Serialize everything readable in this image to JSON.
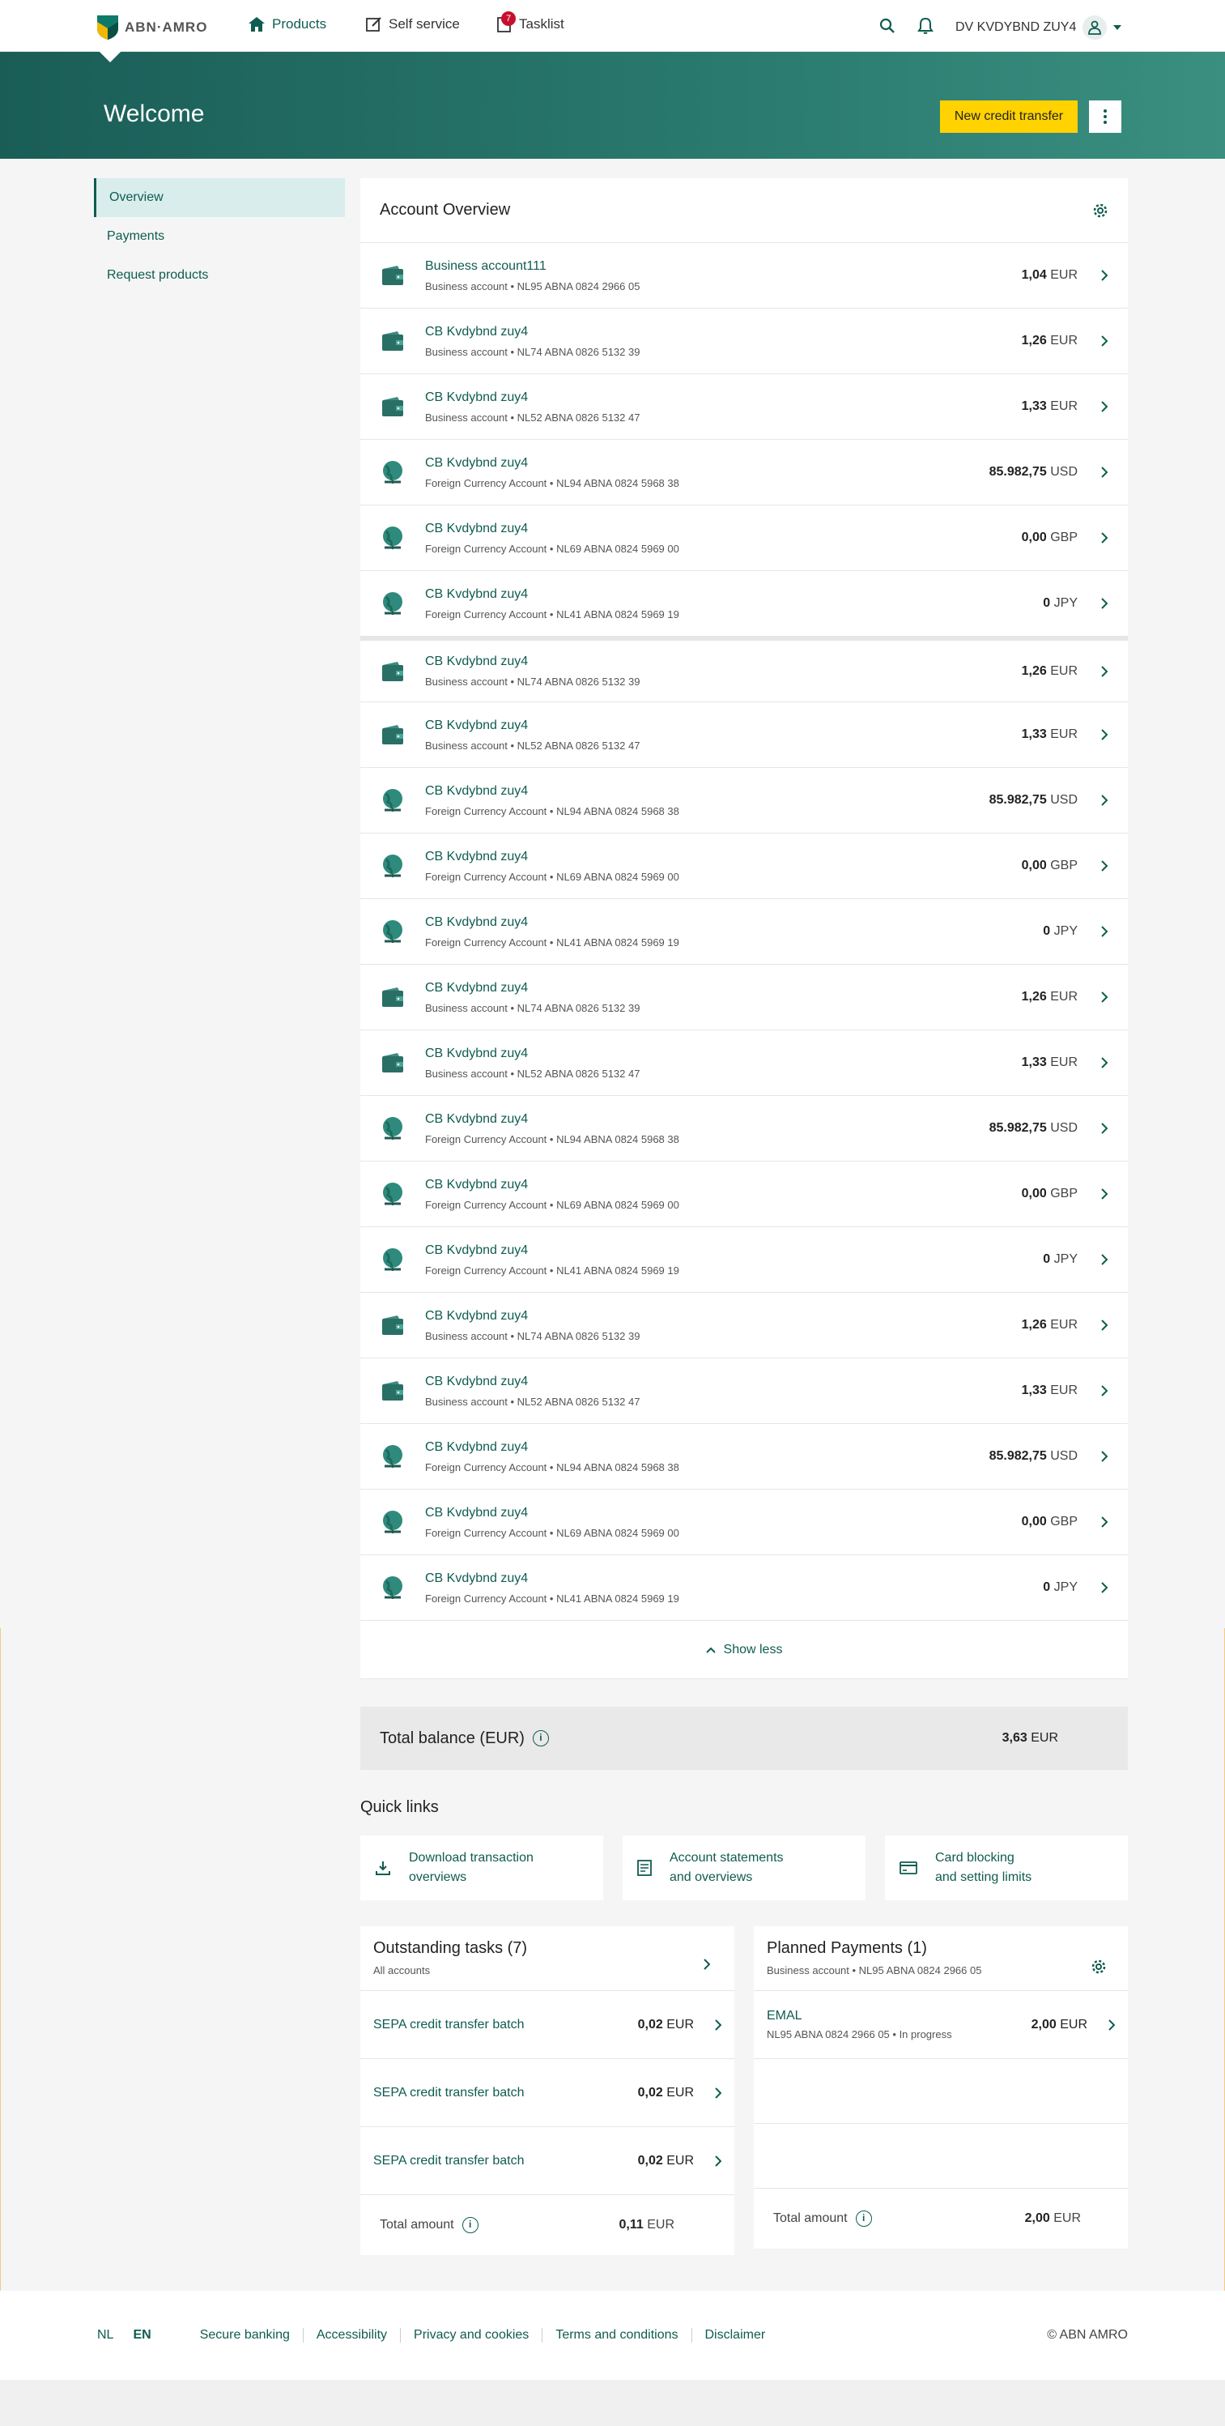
{
  "nav": {
    "logo_text": "ABN·AMRO",
    "items": [
      {
        "label": "Products",
        "icon": "home-icon"
      },
      {
        "label": "Self service",
        "icon": "edit-icon"
      },
      {
        "label": "Tasklist",
        "icon": "task-icon",
        "badge": "7"
      }
    ],
    "user_name": "DV KVDYBND ZUY4"
  },
  "hero": {
    "title": "Welcome",
    "primary_button": "New credit transfer"
  },
  "sidebar": {
    "items": [
      {
        "label": "Overview",
        "active": true
      },
      {
        "label": "Payments"
      },
      {
        "label": "Request products"
      }
    ]
  },
  "accounts": {
    "title": "Account Overview",
    "rows": [
      {
        "name": "Business account111",
        "sub": "Business account • NL95 ABNA 0824 2966 05",
        "amount": "1,04",
        "currency": "EUR",
        "type": "business"
      },
      {
        "name": "CB Kvdybnd zuy4",
        "sub": "Business account • NL74 ABNA 0826 5132 39",
        "amount": "1,26",
        "currency": "EUR",
        "type": "business"
      },
      {
        "name": "CB Kvdybnd zuy4",
        "sub": "Business account • NL52 ABNA 0826 5132 47",
        "amount": "1,33",
        "currency": "EUR",
        "type": "business"
      },
      {
        "name": "CB Kvdybnd zuy4",
        "sub": "Foreign Currency Account • NL94 ABNA 0824 5968 38",
        "amount": "85.982,75",
        "currency": "USD",
        "type": "foreign"
      },
      {
        "name": "CB Kvdybnd zuy4",
        "sub": "Foreign Currency Account • NL69 ABNA 0824 5969 00",
        "amount": "0,00",
        "currency": "GBP",
        "type": "foreign"
      },
      {
        "name": "CB Kvdybnd zuy4",
        "sub": "Foreign Currency Account • NL41 ABNA 0824 5969 19",
        "amount": "0",
        "currency": "JPY",
        "type": "foreign"
      },
      {
        "name": "CB Kvdybnd zuy4",
        "sub": "Business account • NL74 ABNA 0826 5132 39",
        "amount": "1,26",
        "currency": "EUR",
        "type": "business"
      },
      {
        "name": "CB Kvdybnd zuy4",
        "sub": "Business account • NL52 ABNA 0826 5132 47",
        "amount": "1,33",
        "currency": "EUR",
        "type": "business"
      },
      {
        "name": "CB Kvdybnd zuy4",
        "sub": "Foreign Currency Account • NL94 ABNA 0824 5968 38",
        "amount": "85.982,75",
        "currency": "USD",
        "type": "foreign"
      },
      {
        "name": "CB Kvdybnd zuy4",
        "sub": "Foreign Currency Account • NL69 ABNA 0824 5969 00",
        "amount": "0,00",
        "currency": "GBP",
        "type": "foreign"
      },
      {
        "name": "CB Kvdybnd zuy4",
        "sub": "Foreign Currency Account • NL41 ABNA 0824 5969 19",
        "amount": "0",
        "currency": "JPY",
        "type": "foreign"
      },
      {
        "name": "CB Kvdybnd zuy4",
        "sub": "Business account • NL74 ABNA 0826 5132 39",
        "amount": "1,26",
        "currency": "EUR",
        "type": "business"
      },
      {
        "name": "CB Kvdybnd zuy4",
        "sub": "Business account • NL52 ABNA 0826 5132 47",
        "amount": "1,33",
        "currency": "EUR",
        "type": "business"
      },
      {
        "name": "CB Kvdybnd zuy4",
        "sub": "Foreign Currency Account • NL94 ABNA 0824 5968 38",
        "amount": "85.982,75",
        "currency": "USD",
        "type": "foreign"
      },
      {
        "name": "CB Kvdybnd zuy4",
        "sub": "Foreign Currency Account • NL69 ABNA 0824 5969 00",
        "amount": "0,00",
        "currency": "GBP",
        "type": "foreign"
      },
      {
        "name": "CB Kvdybnd zuy4",
        "sub": "Foreign Currency Account • NL41 ABNA 0824 5969 19",
        "amount": "0",
        "currency": "JPY",
        "type": "foreign"
      },
      {
        "name": "CB Kvdybnd zuy4",
        "sub": "Business account • NL74 ABNA 0826 5132 39",
        "amount": "1,26",
        "currency": "EUR",
        "type": "business"
      },
      {
        "name": "CB Kvdybnd zuy4",
        "sub": "Business account • NL52 ABNA 0826 5132 47",
        "amount": "1,33",
        "currency": "EUR",
        "type": "business"
      },
      {
        "name": "CB Kvdybnd zuy4",
        "sub": "Foreign Currency Account • NL94 ABNA 0824 5968 38",
        "amount": "85.982,75",
        "currency": "USD",
        "type": "foreign"
      },
      {
        "name": "CB Kvdybnd zuy4",
        "sub": "Foreign Currency Account • NL69 ABNA 0824 5969 00",
        "amount": "0,00",
        "currency": "GBP",
        "type": "foreign"
      },
      {
        "name": "CB Kvdybnd zuy4",
        "sub": "Foreign Currency Account • NL41 ABNA 0824 5969 19",
        "amount": "0",
        "currency": "JPY",
        "type": "foreign"
      }
    ],
    "show_less": "Show less"
  },
  "total": {
    "label": "Total balance (EUR)",
    "amount": "3,63",
    "currency": "EUR"
  },
  "quick_links": {
    "title": "Quick links",
    "items": [
      {
        "line1": "Download transaction",
        "line2": "overviews",
        "icon": "download-icon"
      },
      {
        "line1": "Account statements",
        "line2": "and overviews",
        "icon": "document-icon"
      },
      {
        "line1": "Card blocking",
        "line2": "and setting limits",
        "icon": "card-icon"
      }
    ]
  },
  "tasks": {
    "title": "Outstanding tasks (7)",
    "sub": "All accounts",
    "rows": [
      {
        "name": "SEPA credit transfer batch",
        "amount": "0,02",
        "currency": "EUR"
      },
      {
        "name": "SEPA credit transfer batch",
        "amount": "0,02",
        "currency": "EUR"
      },
      {
        "name": "SEPA credit transfer batch",
        "amount": "0,02",
        "currency": "EUR"
      }
    ],
    "total_label": "Total amount",
    "total_amount": "0,11",
    "total_currency": "EUR"
  },
  "planned": {
    "title": "Planned Payments (1)",
    "sub": "Business account • NL95 ABNA 0824 2966 05",
    "rows": [
      {
        "name": "EMAL",
        "sub": "NL95 ABNA 0824 2966 05 • In progress",
        "amount": "2,00",
        "currency": "EUR"
      }
    ],
    "total_label": "Total amount",
    "total_amount": "2,00",
    "total_currency": "EUR"
  },
  "footer": {
    "lang_nl": "NL",
    "lang_en": "EN",
    "links": [
      "Secure banking",
      "Accessibility",
      "Privacy and cookies",
      "Terms and conditions",
      "Disclaimer"
    ],
    "copyright": "© ABN AMRO"
  },
  "colors": {
    "brand_green": "#0f5c50",
    "hero_start": "#1a5d57",
    "hero_end": "#3a8f80",
    "button_yellow": "#ffd200",
    "badge_red": "#c8102e"
  }
}
